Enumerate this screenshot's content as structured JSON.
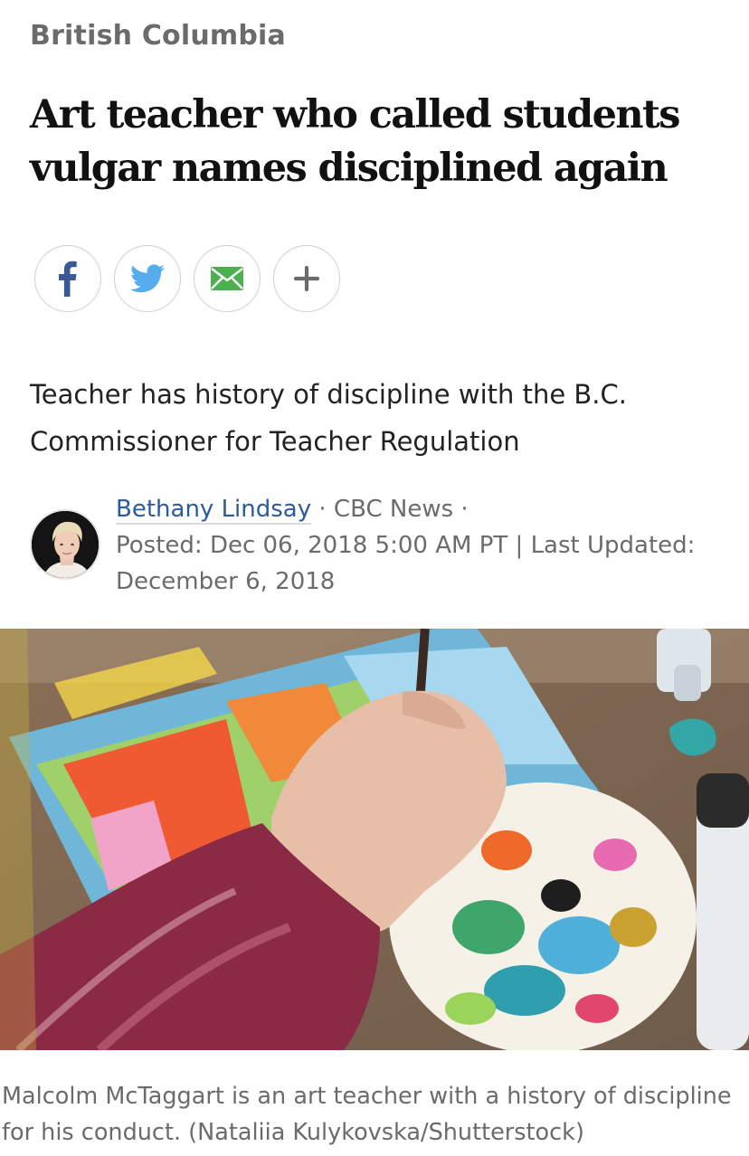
{
  "article": {
    "section": "British Columbia",
    "headline": "Art teacher who called students vulgar names disciplined again",
    "deck": "Teacher has history of discipline with the B.C. Commissioner for Teacher Regulation"
  },
  "share": {
    "buttons": [
      {
        "name": "facebook",
        "icon": "facebook-icon",
        "color": "#3b5998"
      },
      {
        "name": "twitter",
        "icon": "twitter-icon",
        "color": "#55acee"
      },
      {
        "name": "email",
        "icon": "email-icon",
        "color": "#4caf50"
      },
      {
        "name": "more",
        "icon": "plus-icon",
        "color": "#6b6b6b"
      }
    ]
  },
  "byline": {
    "author": "Bethany Lindsay",
    "separator": " · ",
    "outlet": "CBC News",
    "trailing_separator": " ·",
    "posted_label": "Posted: ",
    "posted": "Dec 06, 2018 5:00 AM PT",
    "pipe": " | ",
    "updated_label": "Last Updated: ",
    "updated": "December 6, 2018"
  },
  "image": {
    "caption": "Malcolm McTaggart is an art teacher with a history of discipline for his conduct. (Nataliia Kulykovska/Shutterstock)"
  },
  "colors": {
    "link": "#2c5b9a",
    "muted": "#6b6b6b",
    "headline": "#111111"
  }
}
